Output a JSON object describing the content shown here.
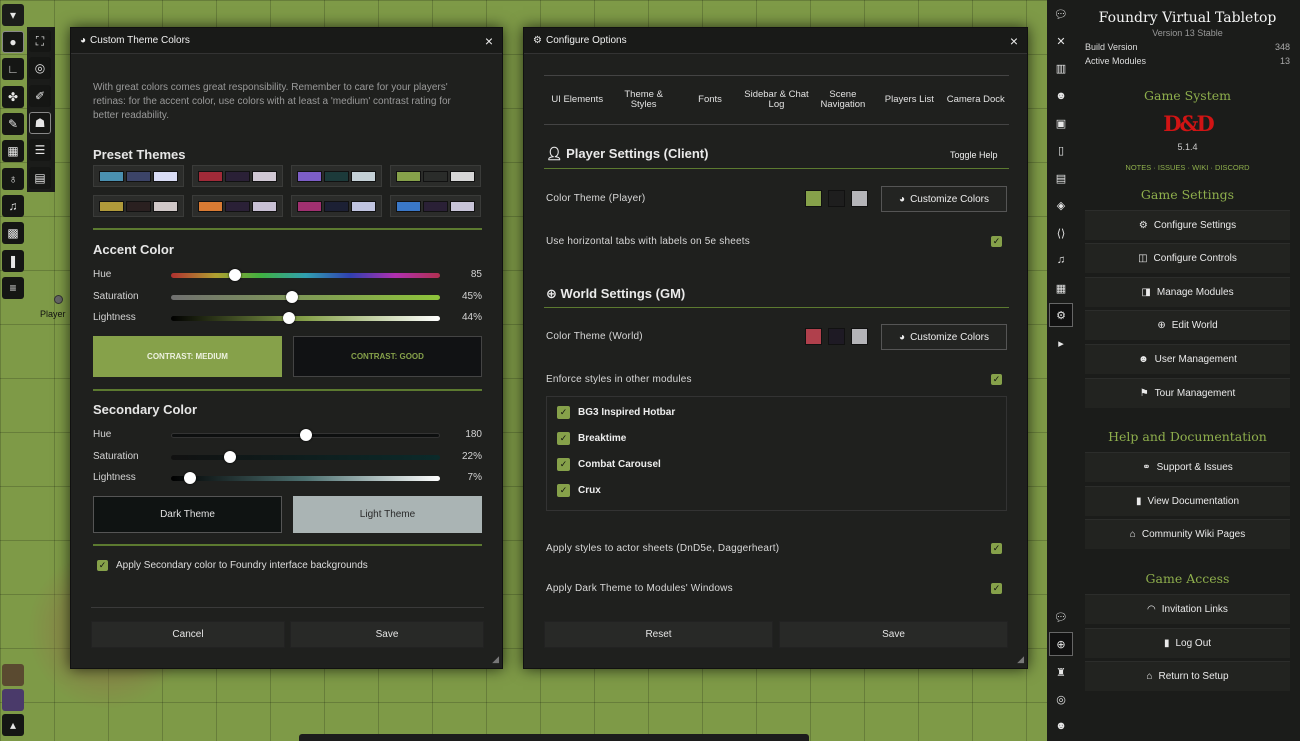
{
  "theme_window": {
    "title": "Custom Theme Colors",
    "intro": "With great colors comes great responsibility. Remember to care for your players' retinas: for the accent color, use colors with at least a 'medium' contrast rating for better readability.",
    "preset_title": "Preset Themes",
    "presets": [
      [
        "#4a90b0",
        "#3c4468",
        "#d9dcf5"
      ],
      [
        "#a02a38",
        "#2a2036",
        "#d0c8d4"
      ],
      [
        "#7d5ec7",
        "#1c3a3a",
        "#c4d0d6"
      ],
      [
        "#86a14a",
        "#2a2c2a",
        "#d6d6d6"
      ],
      [
        "#b09a3a",
        "#2a2020",
        "#d0c8c8"
      ],
      [
        "#d97b33",
        "#2a2036",
        "#c8c0d4"
      ],
      [
        "#a03070",
        "#1c2034",
        "#c0c4e0"
      ],
      [
        "#3a78c8",
        "#2a2036",
        "#c8c4d8"
      ]
    ],
    "accent": {
      "title": "Accent Color",
      "hue_label": "Hue",
      "hue_value": "85",
      "hue": 85,
      "saturation_label": "Saturation",
      "saturation_value": "45%",
      "saturation": 45,
      "lightness_label": "Lightness",
      "lightness_value": "44%",
      "lightness": 44,
      "contrast_medium": "CONTRAST: MEDIUM",
      "contrast_good": "CONTRAST: GOOD"
    },
    "secondary": {
      "title": "Secondary Color",
      "hue_label": "Hue",
      "hue_value": "180",
      "hue": 180,
      "saturation_label": "Saturation",
      "saturation_value": "22%",
      "saturation": 22,
      "lightness_label": "Lightness",
      "lightness_value": "7%",
      "lightness": 7,
      "dark_theme": "Dark Theme",
      "light_theme": "Light Theme"
    },
    "apply_label": "Apply Secondary color to Foundry interface backgrounds",
    "cancel": "Cancel",
    "save": "Save"
  },
  "config_window": {
    "title": "Configure Options",
    "tabs": [
      "UI Elements",
      "Theme & Styles",
      "Fonts",
      "Sidebar & Chat Log",
      "Scene Navigation",
      "Players List",
      "Camera Dock"
    ],
    "player_head": "Player Settings (Client)",
    "toggle_help": "Toggle Help",
    "color_theme_player": "Color Theme (Player)",
    "player_swatches": [
      "#86a14a",
      "#1e1e1e",
      "#b4b4b8"
    ],
    "customize_colors": "Customize Colors",
    "horizontal_tabs": "Use horizontal tabs with labels on 5e sheets",
    "world_head": "World Settings (GM)",
    "color_theme_world": "Color Theme (World)",
    "world_swatches": [
      "#b0404c",
      "#1e1a24",
      "#b4b4b8"
    ],
    "enforce": "Enforce styles in other modules",
    "modules": [
      "BG3 Inspired Hotbar",
      "Breaktime",
      "Combat Carousel",
      "Crux"
    ],
    "actor_sheets": "Apply styles to actor sheets (DnD5e, Daggerheart)",
    "dark_modules": "Apply Dark Theme to Modules' Windows",
    "reset": "Reset",
    "save": "Save"
  },
  "map": {
    "player_label": "Player"
  },
  "sidebar": {
    "title": "Foundry Virtual Tabletop",
    "version": "Version 13 Stable",
    "build_label": "Build Version",
    "build_value": "348",
    "modules_label": "Active Modules",
    "modules_value": "13",
    "game_system": "Game System",
    "system_logo": "D&D",
    "system_version": "5.1.4",
    "system_links": "NOTES · ISSUES · WIKI · DISCORD",
    "game_settings": "Game Settings",
    "configure_settings": "Configure Settings",
    "configure_controls": "Configure Controls",
    "manage_modules": "Manage Modules",
    "edit_world": "Edit World",
    "user_management": "User Management",
    "tour_management": "Tour Management",
    "help_docs": "Help and Documentation",
    "support_issues": "Support & Issues",
    "view_docs": "View Documentation",
    "wiki_pages": "Community Wiki Pages",
    "game_access": "Game Access",
    "invitation_links": "Invitation Links",
    "log_out": "Log Out",
    "return_setup": "Return to Setup"
  }
}
